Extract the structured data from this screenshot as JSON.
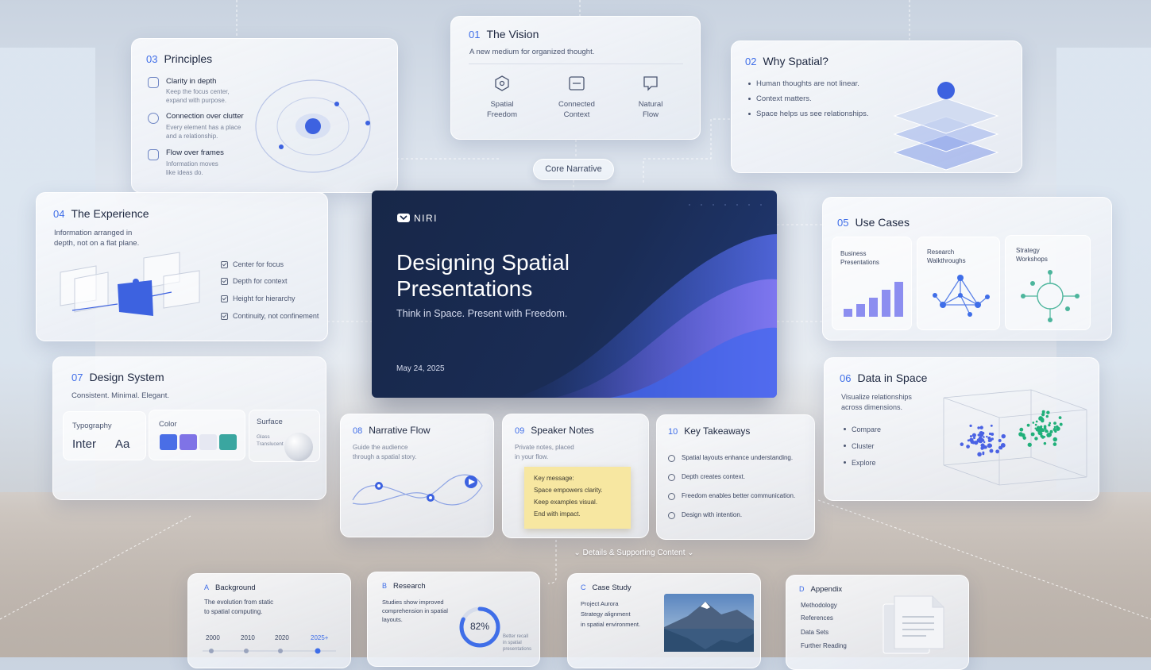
{
  "core_label": "Core Narrative",
  "details_label": "Details & Supporting Content",
  "hero": {
    "brand": "NIRI",
    "title_line1": "Designing Spatial",
    "title_line2": "Presentations",
    "subtitle": "Think in Space. Present with Freedom.",
    "date": "May 24, 2025"
  },
  "vision": {
    "num": "01",
    "title": "The Vision",
    "subtitle": "A new medium for organized thought.",
    "items": [
      {
        "line1": "Spatial",
        "line2": "Freedom",
        "icon": "hexagon-icon"
      },
      {
        "line1": "Connected",
        "line2": "Context",
        "icon": "link-box-icon"
      },
      {
        "line1": "Natural",
        "line2": "Flow",
        "icon": "chat-bubble-icon"
      }
    ]
  },
  "why": {
    "num": "02",
    "title": "Why Spatial?",
    "bullets": [
      "Human thoughts are not linear.",
      "Context matters.",
      "Space helps us see relationships."
    ]
  },
  "principles": {
    "num": "03",
    "title": "Principles",
    "items": [
      {
        "title": "Clarity in depth",
        "d1": "Keep the focus center,",
        "d2": "expand with purpose."
      },
      {
        "title": "Connection over clutter",
        "d1": "Every element has a place",
        "d2": "and a relationship."
      },
      {
        "title": "Flow over frames",
        "d1": "Information moves",
        "d2": "like ideas do."
      }
    ]
  },
  "experience": {
    "num": "04",
    "title": "The Experience",
    "desc1": "Information arranged in",
    "desc2": "depth, not on a flat plane.",
    "checks": [
      "Center for focus",
      "Depth for context",
      "Height for hierarchy",
      "Continuity, not confinement"
    ]
  },
  "usecases": {
    "num": "05",
    "title": "Use Cases",
    "items": [
      {
        "l1": "Business",
        "l2": "Presentations"
      },
      {
        "l1": "Research",
        "l2": "Walkthroughs"
      },
      {
        "l1": "Strategy",
        "l2": "Workshops"
      }
    ]
  },
  "dataspace": {
    "num": "06",
    "title": "Data in Space",
    "desc1": "Visualize relationships",
    "desc2": "across dimensions.",
    "bullets": [
      "Compare",
      "Cluster",
      "Explore"
    ]
  },
  "design": {
    "num": "07",
    "title": "Design System",
    "subtitle": "Consistent. Minimal. Elegant.",
    "typo_label": "Typography",
    "typo_font": "Inter",
    "typo_sample": "Aa",
    "color_label": "Color",
    "colors": [
      "#4a6ee6",
      "#7f73e6",
      "#e6e8f2",
      "#3aa6a0"
    ],
    "surface_label": "Surface",
    "surface_l1": "Glass",
    "surface_l2": "Translucent"
  },
  "narrative": {
    "num": "08",
    "title": "Narrative Flow",
    "d1": "Guide the audience",
    "d2": "through a spatial story."
  },
  "notes": {
    "num": "09",
    "title": "Speaker Notes",
    "d1": "Private notes, placed",
    "d2": "in your flow.",
    "sticky": [
      "Key message:",
      "Space empowers clarity.",
      "Keep examples visual.",
      "End with impact."
    ]
  },
  "takeaways": {
    "num": "10",
    "title": "Key Takeaways",
    "items": [
      "Spatial layouts enhance understanding.",
      "Depth creates context.",
      "Freedom enables better communication.",
      "Design with intention."
    ]
  },
  "background": {
    "num": "A",
    "title": "Background",
    "d1": "The evolution from static",
    "d2": "to spatial computing.",
    "years": [
      "2000",
      "2010",
      "2020",
      "2025+"
    ]
  },
  "research": {
    "num": "B",
    "title": "Research",
    "d1": "Studies show improved",
    "d2": "comprehension in spatial",
    "d3": "layouts.",
    "percent_label": "82%",
    "percent_value": 82,
    "note1": "Better recall",
    "note2": "in spatial",
    "note3": "presentations"
  },
  "casestudy": {
    "num": "C",
    "title": "Case Study",
    "d1": "Project Aurora",
    "d2": "Strategy alignment",
    "d3": "in spatial environment."
  },
  "appendix": {
    "num": "D",
    "title": "Appendix",
    "items": [
      "Methodology",
      "References",
      "Data Sets",
      "Further Reading"
    ]
  }
}
